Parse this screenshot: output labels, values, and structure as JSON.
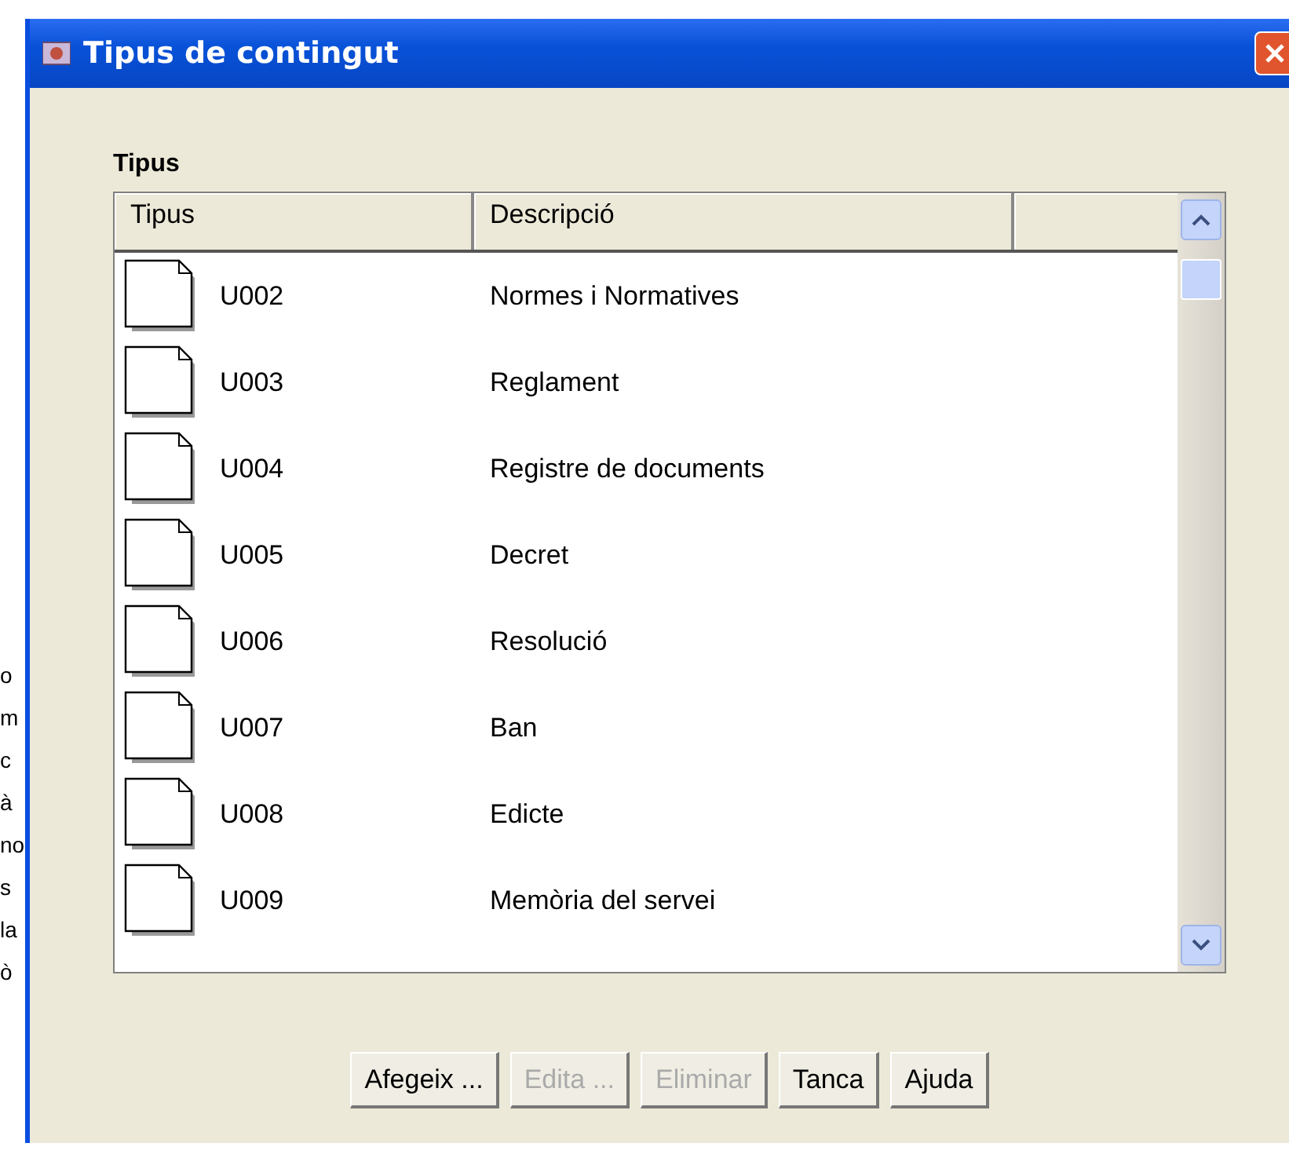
{
  "background_text": [
    "o",
    "m",
    "c",
    "à",
    "no",
    "s",
    "la",
    "ò"
  ],
  "window": {
    "title": "Tipus de contingut"
  },
  "section_label": "Tipus",
  "table": {
    "columns": [
      "Tipus",
      "Descripció"
    ],
    "rows": [
      {
        "code": "U002",
        "description": "Normes i Normatives"
      },
      {
        "code": "U003",
        "description": "Reglament"
      },
      {
        "code": "U004",
        "description": "Registre de documents"
      },
      {
        "code": "U005",
        "description": "Decret"
      },
      {
        "code": "U006",
        "description": "Resolució"
      },
      {
        "code": "U007",
        "description": "Ban"
      },
      {
        "code": "U008",
        "description": "Edicte"
      },
      {
        "code": "U009",
        "description": "Memòria del servei"
      }
    ]
  },
  "buttons": [
    {
      "label": "Afegeix ...",
      "disabled": false
    },
    {
      "label": "Edita ...",
      "disabled": true
    },
    {
      "label": "Eliminar",
      "disabled": true
    },
    {
      "label": "Tanca",
      "disabled": false
    },
    {
      "label": "Ajuda",
      "disabled": false
    }
  ]
}
